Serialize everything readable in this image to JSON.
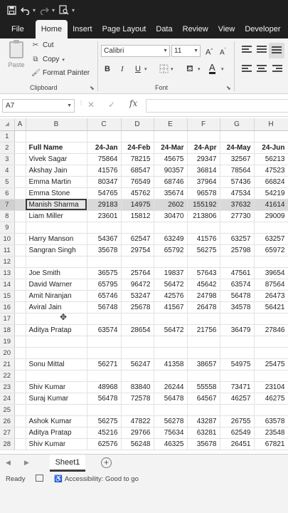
{
  "title_bar": {
    "icons": [
      "save-icon",
      "undo-icon",
      "redo-icon",
      "print-preview-icon",
      "customize-quick-access-icon"
    ]
  },
  "ribbon_tabs": [
    "File",
    "Home",
    "Insert",
    "Page Layout",
    "Data",
    "Review",
    "View",
    "Developer"
  ],
  "active_tab": "Home",
  "clipboard": {
    "paste": "Paste",
    "cut": "Cut",
    "copy": "Copy",
    "format_painter": "Format Painter",
    "group_label": "Clipboard"
  },
  "font": {
    "family": "Calibri",
    "size": "11",
    "bold": "B",
    "italic": "I",
    "underline": "U",
    "grow": "A",
    "shrink": "A",
    "font_color_letter": "A",
    "group_label": "Font"
  },
  "formula_bar": {
    "name_box": "A7",
    "fx": "fx",
    "formula": ""
  },
  "columns": [
    "A",
    "B",
    "C",
    "D",
    "E",
    "F",
    "G",
    "H"
  ],
  "rows": [
    {
      "n": "1",
      "name": "",
      "v": [
        "",
        "",
        "",
        "",
        "",
        ""
      ]
    },
    {
      "n": "2",
      "name": "Full Name",
      "v": [
        "24-Jan",
        "24-Feb",
        "24-Mar",
        "24-Apr",
        "24-May",
        "24-Jun"
      ],
      "header": true
    },
    {
      "n": "3",
      "name": "Vivek Sagar",
      "v": [
        "75864",
        "78215",
        "45675",
        "29347",
        "32567",
        "56213"
      ]
    },
    {
      "n": "4",
      "name": "Akshay Jain",
      "v": [
        "41576",
        "68547",
        "90357",
        "36814",
        "78564",
        "47523"
      ]
    },
    {
      "n": "5",
      "name": "Emma Martin",
      "v": [
        "80347",
        "76549",
        "68746",
        "37964",
        "57436",
        "66824"
      ]
    },
    {
      "n": "6",
      "name": "Emma Stone",
      "v": [
        "54765",
        "45762",
        "35674",
        "96578",
        "47534",
        "54219"
      ]
    },
    {
      "n": "7",
      "name": "Manish Sharma",
      "v": [
        "29183",
        "14975",
        "2602",
        "155192",
        "37632",
        "41614"
      ],
      "selected": true
    },
    {
      "n": "8",
      "name": "Liam Miller",
      "v": [
        "23601",
        "15812",
        "30470",
        "213806",
        "27730",
        "29009"
      ]
    },
    {
      "n": "9",
      "name": "",
      "v": [
        "",
        "",
        "",
        "",
        "",
        ""
      ]
    },
    {
      "n": "10",
      "name": "Harry Manson",
      "v": [
        "54367",
        "62547",
        "63249",
        "41576",
        "63257",
        "63257"
      ]
    },
    {
      "n": "11",
      "name": "Sangran Singh",
      "v": [
        "35678",
        "29754",
        "65792",
        "56275",
        "25798",
        "65972"
      ]
    },
    {
      "n": "12",
      "name": "",
      "v": [
        "",
        "",
        "",
        "",
        "",
        ""
      ]
    },
    {
      "n": "13",
      "name": "Joe Smith",
      "v": [
        "36575",
        "25764",
        "19837",
        "57643",
        "47561",
        "39654"
      ]
    },
    {
      "n": "14",
      "name": "David Warner",
      "v": [
        "65795",
        "96472",
        "56472",
        "45642",
        "63574",
        "87564"
      ]
    },
    {
      "n": "15",
      "name": "Amit Niranjan",
      "v": [
        "65746",
        "53247",
        "42576",
        "24798",
        "56478",
        "26473"
      ]
    },
    {
      "n": "16",
      "name": "Aviral Jain",
      "v": [
        "56748",
        "25678",
        "41567",
        "26478",
        "34578",
        "56421"
      ]
    },
    {
      "n": "17",
      "name": "",
      "v": [
        "",
        "",
        "",
        "",
        "",
        ""
      ]
    },
    {
      "n": "18",
      "name": "Aditya Pratap",
      "v": [
        "63574",
        "28654",
        "56472",
        "21756",
        "36479",
        "27846"
      ]
    },
    {
      "n": "19",
      "name": "",
      "v": [
        "",
        "",
        "",
        "",
        "",
        ""
      ]
    },
    {
      "n": "20",
      "name": "",
      "v": [
        "",
        "",
        "",
        "",
        "",
        ""
      ]
    },
    {
      "n": "21",
      "name": "Sonu Mittal",
      "v": [
        "56271",
        "56247",
        "41358",
        "38657",
        "54975",
        "25475"
      ]
    },
    {
      "n": "22",
      "name": "",
      "v": [
        "",
        "",
        "",
        "",
        "",
        ""
      ]
    },
    {
      "n": "23",
      "name": "Shiv Kumar",
      "v": [
        "48968",
        "83840",
        "26244",
        "55558",
        "73471",
        "23104"
      ]
    },
    {
      "n": "24",
      "name": "Suraj Kumar",
      "v": [
        "56478",
        "72578",
        "56478",
        "64567",
        "46257",
        "46275"
      ]
    },
    {
      "n": "25",
      "name": "",
      "v": [
        "",
        "",
        "",
        "",
        "",
        ""
      ]
    },
    {
      "n": "26",
      "name": "Ashok Kumar",
      "v": [
        "56275",
        "47822",
        "56278",
        "43287",
        "26755",
        "63578"
      ]
    },
    {
      "n": "27",
      "name": "Aditya Pratap",
      "v": [
        "45216",
        "29766",
        "75634",
        "63281",
        "62549",
        "23548"
      ]
    },
    {
      "n": "28",
      "name": "Shiv Kumar",
      "v": [
        "62576",
        "56248",
        "46325",
        "35678",
        "26451",
        "67821"
      ]
    }
  ],
  "sheet_tabs": [
    "Sheet1"
  ],
  "status": {
    "ready": "Ready",
    "accessibility": "Accessibility: Good to go"
  }
}
